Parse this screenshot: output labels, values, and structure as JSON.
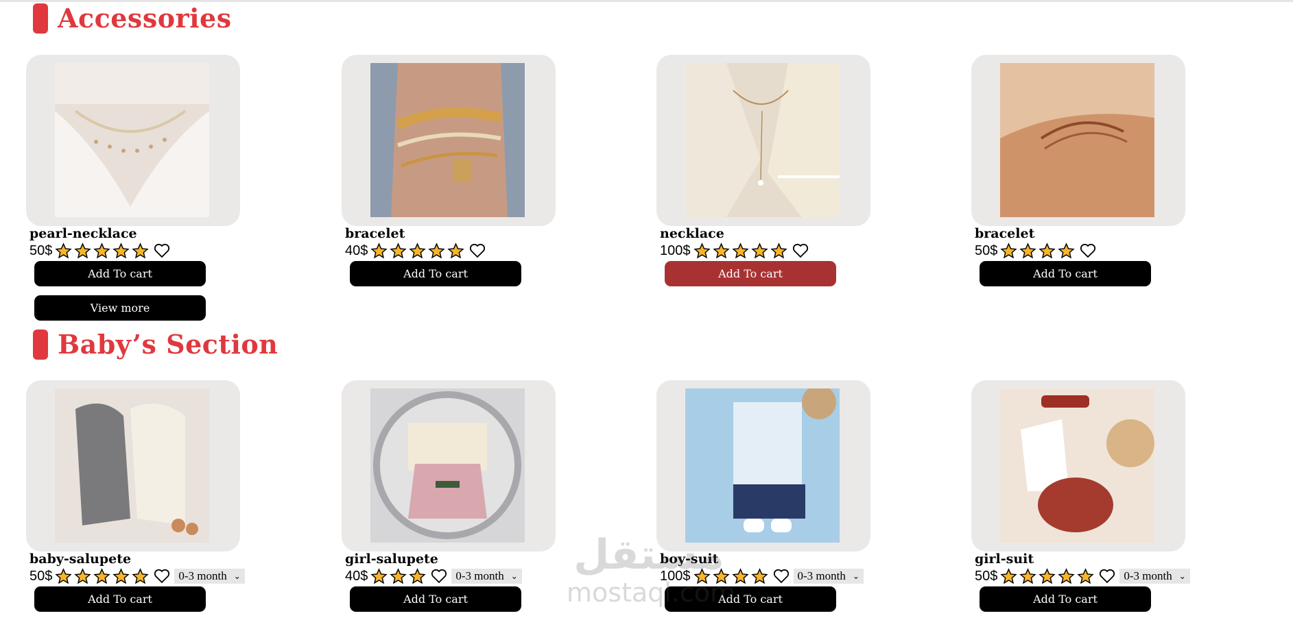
{
  "sections": {
    "accessories": {
      "title": "Accessories"
    },
    "baby": {
      "title": "Baby’s Section"
    }
  },
  "accessories": [
    {
      "name": "pearl-necklace",
      "price": "50$",
      "stars": 5,
      "cart": "Add To cart"
    },
    {
      "name": "bracelet",
      "price": "40$",
      "stars": 5,
      "cart": "Add To cart"
    },
    {
      "name": "necklace",
      "price": "100$",
      "stars": 5,
      "cart": "Add To cart"
    },
    {
      "name": "bracelet",
      "price": "50$",
      "stars": 4,
      "cart": "Add To cart"
    }
  ],
  "view_more": "View more",
  "baby": [
    {
      "name": "baby-salupete",
      "price": "50$",
      "stars": 5,
      "size": "0-3 month",
      "cart": "Add To cart"
    },
    {
      "name": "girl-salupete",
      "price": "40$",
      "stars": 3,
      "size": "0-3 month",
      "cart": "Add To cart"
    },
    {
      "name": "boy-suit",
      "price": "100$",
      "stars": 4,
      "size": "0-3 month",
      "cart": "Add To cart"
    },
    {
      "name": "girl-suit",
      "price": "50$",
      "stars": 5,
      "size": "0-3 month",
      "cart": "Add To cart"
    }
  ],
  "watermark": {
    "arabic": "مستقل",
    "latin": "mostaql.com"
  },
  "colors": {
    "accent": "#e0383e",
    "button": "#000000",
    "button_active": "#a83232",
    "card_bg": "#ebe9e8",
    "star": "#f7b52b"
  }
}
